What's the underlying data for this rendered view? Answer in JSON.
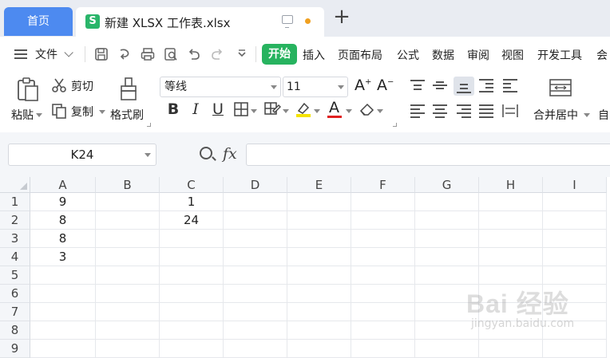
{
  "tabs": {
    "home_label": "首页",
    "doc_icon_text": "S",
    "doc_title": "新建 XLSX 工作表.xlsx",
    "new_tab_symbol": "+"
  },
  "menubar": {
    "file_label": "文件",
    "start_label": "开始",
    "items": [
      "插入",
      "页面布局",
      "公式",
      "数据",
      "审阅",
      "视图",
      "开发工具",
      "会"
    ]
  },
  "ribbon": {
    "paste_label": "粘贴",
    "cut_label": "剪切",
    "copy_label": "复制",
    "format_painter_label": "格式刷",
    "font_name": "等线",
    "font_size": "11",
    "bold": "B",
    "italic": "I",
    "underline": "U",
    "font_color_glyph": "A",
    "merge_center_label": "合并居中",
    "next_group_label": "自"
  },
  "formula_bar": {
    "name_box": "K24",
    "fx_label": "fx",
    "formula": ""
  },
  "sheet": {
    "columns": [
      "A",
      "B",
      "C",
      "D",
      "E",
      "F",
      "G",
      "H",
      "I"
    ],
    "rows": [
      "1",
      "2",
      "3",
      "4",
      "5",
      "6",
      "7",
      "8",
      "9"
    ],
    "cells": {
      "A1": "9",
      "C1": "1",
      "A2": "8",
      "C2": "24",
      "A3": "8",
      "A4": "3"
    }
  },
  "watermark": {
    "main": "Bai 经验",
    "sub": "jingyan.baidu.com"
  },
  "colors": {
    "home_tab": "#4d8af0",
    "start_tab": "#27b35f",
    "doc_icon": "#2ab56a",
    "highlight_yellow": "#f5e300",
    "font_red": "#e02020"
  }
}
